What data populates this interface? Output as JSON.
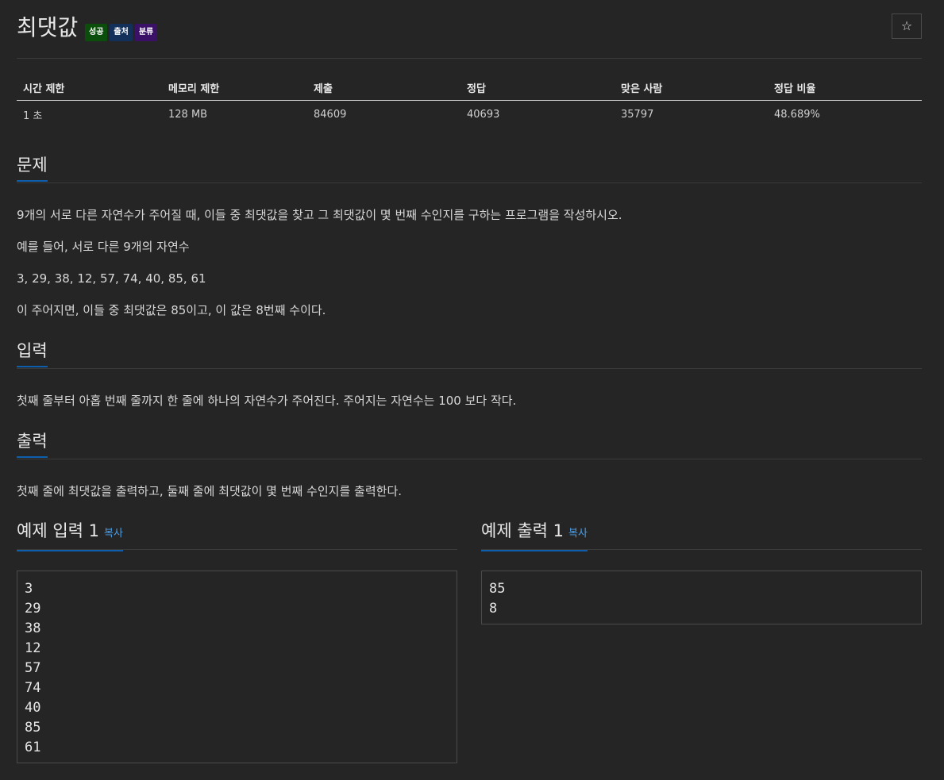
{
  "problem": {
    "title": "최댓값",
    "badges": {
      "success": "성공",
      "source": "출처",
      "category": "분류"
    },
    "star_icon": "☆"
  },
  "info": {
    "headers": [
      "시간 제한",
      "메모리 제한",
      "제출",
      "정답",
      "맞은 사람",
      "정답 비율"
    ],
    "values": [
      "1 초",
      "128 MB",
      "84609",
      "40693",
      "35797",
      "48.689%"
    ]
  },
  "sections": {
    "description": {
      "title": "문제",
      "lines": [
        "9개의 서로 다른 자연수가 주어질 때, 이들 중 최댓값을 찾고 그 최댓값이 몇 번째 수인지를 구하는 프로그램을 작성하시오.",
        "예를 들어, 서로 다른 9개의 자연수",
        "3, 29, 38, 12, 57, 74, 40, 85, 61",
        "이 주어지면, 이들 중 최댓값은 85이고, 이 값은 8번째 수이다."
      ]
    },
    "input": {
      "title": "입력",
      "text": "첫째 줄부터 아홉 번째 줄까지 한 줄에 하나의 자연수가 주어진다. 주어지는 자연수는 100 보다 작다."
    },
    "output": {
      "title": "출력",
      "text": "첫째 줄에 최댓값을 출력하고, 둘째 줄에 최댓값이 몇 번째 수인지를 출력한다."
    }
  },
  "samples": {
    "input": {
      "title": "예제 입력 1",
      "copy": "복사",
      "content": "3\n29\n38\n12\n57\n74\n40\n85\n61"
    },
    "output": {
      "title": "예제 출력 1",
      "copy": "복사",
      "content": "85\n8"
    }
  },
  "colors": {
    "background": "#252526",
    "accent": "#0d5fae",
    "link": "#4a9fe8",
    "badge_success": "#0b4d0b",
    "badge_source": "#12305a",
    "badge_category": "#3a1166"
  }
}
